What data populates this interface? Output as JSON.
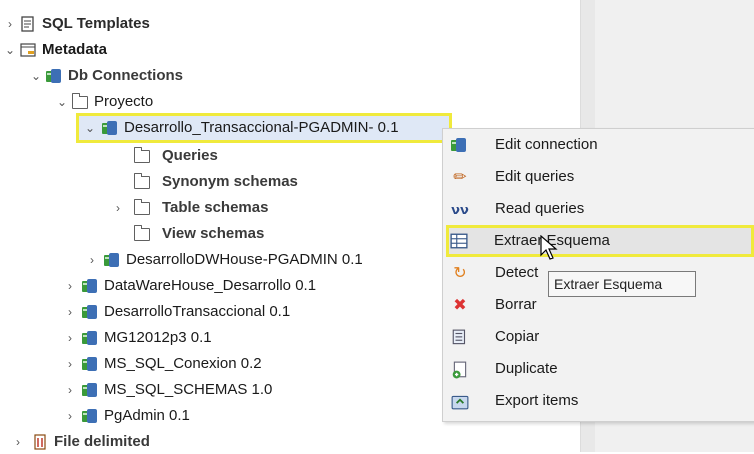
{
  "tree": {
    "sql_templates": "SQL Templates",
    "metadata": "Metadata",
    "db_connections": "Db Connections",
    "proyecto": "Proyecto",
    "selected_item": "Desarrollo_Transaccional-PGADMIN- 0.1",
    "queries": "Queries",
    "synonym_schemas": "Synonym schemas",
    "table_schemas": "Table schemas",
    "view_schemas": "View schemas",
    "connections": [
      "DesarrolloDWHouse-PGADMIN 0.1",
      "DataWareHouse_Desarrollo 0.1",
      "DesarrolloTransaccional 0.1",
      "MG12012p3 0.1",
      "MS_SQL_Conexion 0.2",
      "MS_SQL_SCHEMAS 1.0",
      "PgAdmin 0.1"
    ],
    "file_delimited": "File delimited"
  },
  "menu": {
    "items": [
      {
        "label": "Edit connection",
        "icon": "db-connection-icon"
      },
      {
        "label": "Edit queries",
        "icon": "pencil-icon"
      },
      {
        "label": "Read queries",
        "icon": "glasses-icon"
      },
      {
        "label": "Extraer Esquema",
        "icon": "table-icon"
      },
      {
        "label": "Detect",
        "icon": "detect-icon"
      },
      {
        "label": "Borrar",
        "icon": "delete-x-icon"
      },
      {
        "label": "Copiar",
        "icon": "copy-icon"
      },
      {
        "label": "Duplicate",
        "icon": "duplicate-icon"
      },
      {
        "label": "Export items",
        "icon": "export-icon"
      }
    ],
    "tooltip": "Extraer Esquema"
  },
  "colors": {
    "highlight": "#f0ea3c",
    "delete": "#d33",
    "folder_db_blue": "#3d6fb5",
    "folder_db_green": "#3a9a3a"
  }
}
